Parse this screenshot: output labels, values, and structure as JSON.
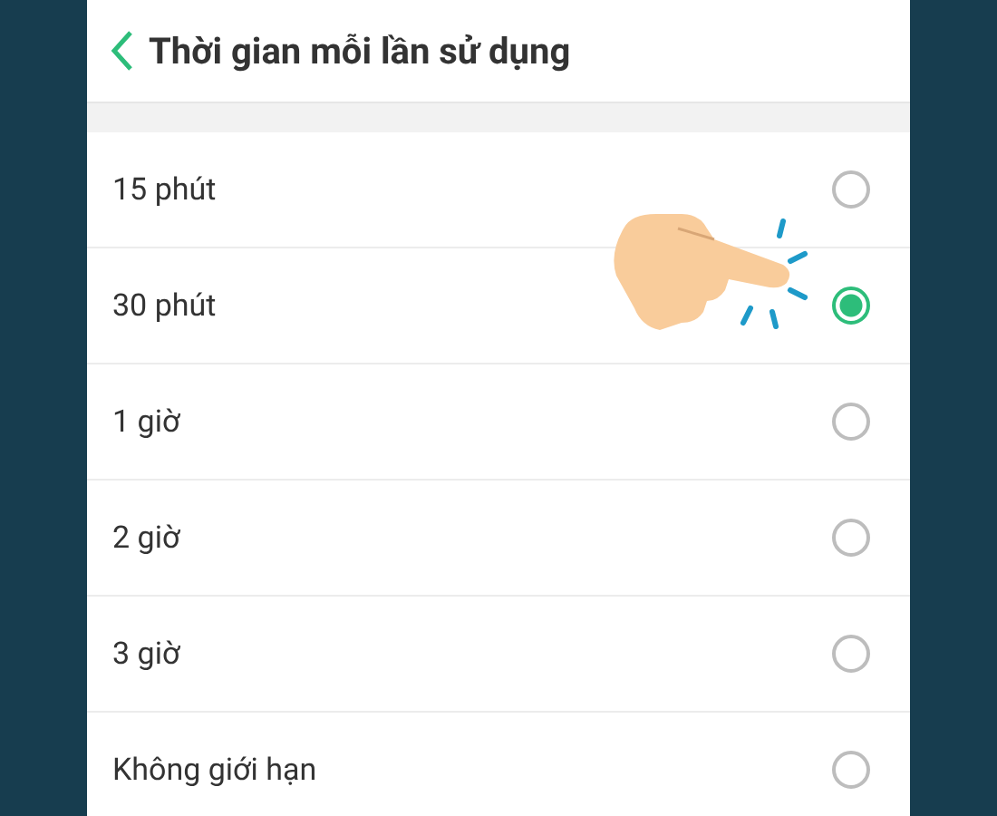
{
  "header": {
    "title": "Thời gian mỗi lần sử dụng"
  },
  "options": [
    {
      "label": "15 phút",
      "selected": false
    },
    {
      "label": "30 phút",
      "selected": true
    },
    {
      "label": "1 giờ",
      "selected": false
    },
    {
      "label": "2 giờ",
      "selected": false
    },
    {
      "label": "3 giờ",
      "selected": false
    },
    {
      "label": "Không giới hạn",
      "selected": false
    }
  ]
}
